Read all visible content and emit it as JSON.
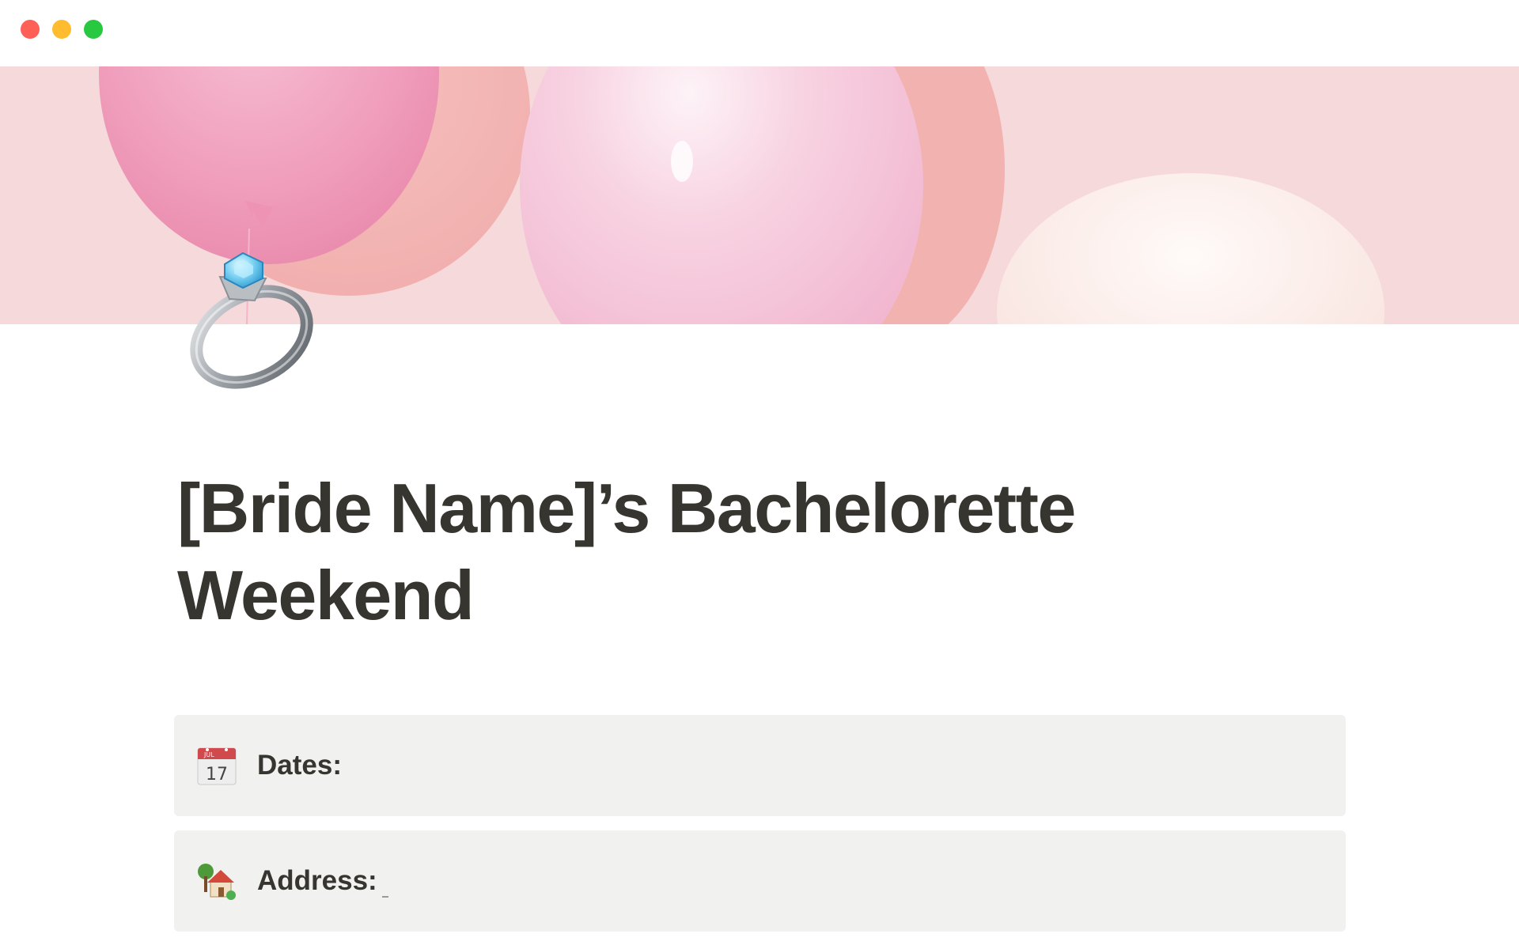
{
  "window": {
    "controls": {
      "close": "close",
      "minimize": "minimize",
      "zoom": "zoom"
    }
  },
  "cover": {
    "image": "pink-balloons-cover",
    "colors": {
      "background": "#f6d9db",
      "balloon_pink": "#ef98b8",
      "balloon_light": "#f7c4d8",
      "balloon_peach": "#f2aaa9",
      "balloon_cream": "#fbe9e6"
    }
  },
  "page": {
    "icon": "ring-icon",
    "title": "[Bride Name]’s Bachelorette Weekend"
  },
  "callouts": [
    {
      "icon": "calendar-icon",
      "label": "Dates:",
      "value": ""
    },
    {
      "icon": "house-with-garden-icon",
      "label": "Address:",
      "value": ""
    }
  ],
  "colors": {
    "text": "#37352f",
    "callout_background": "#f1f1ef"
  }
}
